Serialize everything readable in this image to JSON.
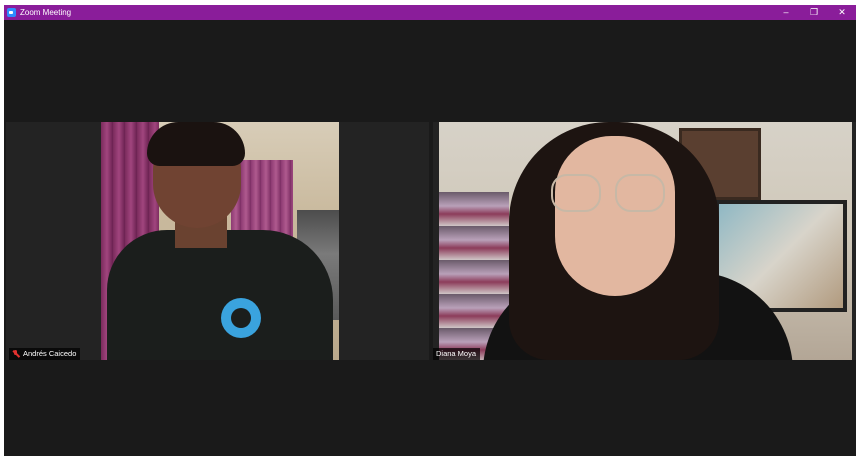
{
  "window": {
    "title": "Zoom Meeting",
    "title_bar_color": "#8a1d9a",
    "controls": {
      "minimize": "–",
      "restore": "❐",
      "close": "✕"
    }
  },
  "participants": [
    {
      "name": "Andrés Caicedo",
      "muted": true
    },
    {
      "name": "Diana Moya",
      "muted": false
    }
  ],
  "colors": {
    "background": "#1a1a1a",
    "mute_indicator": "#e0312f"
  }
}
